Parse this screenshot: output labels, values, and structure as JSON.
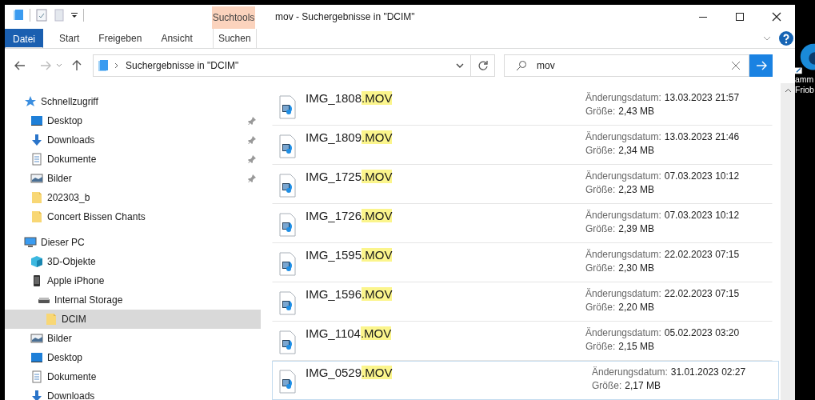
{
  "window": {
    "title": "mov - Suchergebnisse in \"DCIM\""
  },
  "ribbon": {
    "context_label": "Suchtools",
    "tabs": [
      {
        "label": "Datei",
        "kind": "file",
        "selected": false
      },
      {
        "label": "Start",
        "kind": "normal",
        "selected": false
      },
      {
        "label": "Freigeben",
        "kind": "normal",
        "selected": false
      },
      {
        "label": "Ansicht",
        "kind": "normal",
        "selected": false
      },
      {
        "label": "Suchen",
        "kind": "context",
        "selected": false
      }
    ]
  },
  "address": {
    "breadcrumb": "Suchergebnisse in \"DCIM\""
  },
  "search": {
    "value": "mov"
  },
  "navigation": {
    "items": [
      {
        "label": "Schnellzugriff",
        "kind": "star",
        "selected": false,
        "children": [
          {
            "label": "Desktop",
            "kind": "desktop",
            "pinned": true,
            "selected": false
          },
          {
            "label": "Downloads",
            "kind": "download",
            "pinned": true,
            "selected": false
          },
          {
            "label": "Dokumente",
            "kind": "document",
            "pinned": true,
            "selected": false
          },
          {
            "label": "Bilder",
            "kind": "pictures",
            "pinned": true,
            "selected": false
          },
          {
            "label": "202303_b",
            "kind": "folder",
            "pinned": false,
            "selected": false
          },
          {
            "label": "Concert Bissen Chants",
            "kind": "folder",
            "pinned": false,
            "selected": false
          }
        ]
      },
      {
        "label": "Dieser PC",
        "kind": "pc",
        "selected": false,
        "children": [
          {
            "label": "3D-Objekte",
            "kind": "cube",
            "selected": false
          },
          {
            "label": "Apple iPhone",
            "kind": "phone",
            "selected": false,
            "children": [
              {
                "label": "Internal Storage",
                "kind": "drive",
                "selected": false,
                "children": [
                  {
                    "label": "DCIM",
                    "kind": "folder",
                    "selected": true
                  }
                ]
              }
            ]
          },
          {
            "label": "Bilder",
            "kind": "pictures",
            "selected": false
          },
          {
            "label": "Desktop",
            "kind": "desktop",
            "selected": false
          },
          {
            "label": "Dokumente",
            "kind": "document",
            "selected": false
          },
          {
            "label": "Downloads",
            "kind": "download",
            "selected": false
          }
        ]
      }
    ]
  },
  "results": [
    {
      "name": "IMG_1808",
      "match": ".MOV",
      "date_label": "Änderungsdatum:",
      "date": "13.03.2023 21:57",
      "size_label": "Größe:",
      "size": "2,43 MB",
      "focused": false
    },
    {
      "name": "IMG_1809",
      "match": ".MOV",
      "date_label": "Änderungsdatum:",
      "date": "13.03.2023 21:46",
      "size_label": "Größe:",
      "size": "2,34 MB",
      "focused": false
    },
    {
      "name": "IMG_1725",
      "match": ".MOV",
      "date_label": "Änderungsdatum:",
      "date": "07.03.2023 10:12",
      "size_label": "Größe:",
      "size": "2,23 MB",
      "focused": false
    },
    {
      "name": "IMG_1726",
      "match": ".MOV",
      "date_label": "Änderungsdatum:",
      "date": "07.03.2023 10:12",
      "size_label": "Größe:",
      "size": "2,39 MB",
      "focused": false
    },
    {
      "name": "IMG_1595",
      "match": ".MOV",
      "date_label": "Änderungsdatum:",
      "date": "22.02.2023 07:15",
      "size_label": "Größe:",
      "size": "2,30 MB",
      "focused": false
    },
    {
      "name": "IMG_1596",
      "match": ".MOV",
      "date_label": "Änderungsdatum:",
      "date": "22.02.2023 07:15",
      "size_label": "Größe:",
      "size": "2,20 MB",
      "focused": false
    },
    {
      "name": "IMG_1104",
      "match": ".MOV",
      "date_label": "Änderungsdatum:",
      "date": "05.02.2023 03:20",
      "size_label": "Größe:",
      "size": "2,15 MB",
      "focused": false
    },
    {
      "name": "IMG_0529",
      "match": ".MOV",
      "date_label": "Änderungsdatum:",
      "date": "31.01.2023 02:27",
      "size_label": "Größe:",
      "size": "2,17 MB",
      "focused": true
    }
  ],
  "desktop": {
    "label_lines": [
      "amm",
      "Friob"
    ]
  }
}
